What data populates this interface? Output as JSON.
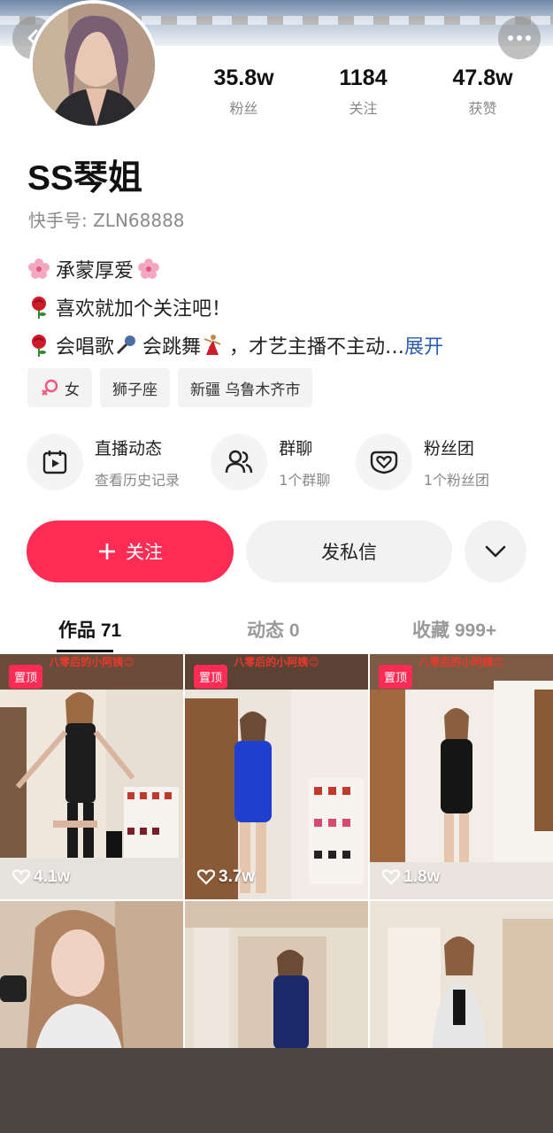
{
  "header": {
    "back_icon": "chevron-left-icon",
    "more_icon": "more-dots-icon"
  },
  "profile": {
    "name": "SS琴姐",
    "kuaishou_id": "快手号: ZLN68888",
    "stats": [
      {
        "value": "35.8w",
        "label": "粉丝"
      },
      {
        "value": "1184",
        "label": "关注"
      },
      {
        "value": "47.8w",
        "label": "获赞"
      }
    ],
    "bio": [
      {
        "emoji": "cherry-blossom-icon",
        "text": "承蒙厚爱"
      },
      {
        "emoji": "rose-icon",
        "text": "喜欢就加个关注吧！"
      },
      {
        "emoji": "rose-icon",
        "text_a": "会唱歌",
        "text_b": "会跳舞",
        "text_c": "，才艺主播不主动…",
        "expand": "展开"
      }
    ],
    "tags": [
      {
        "icon": "female-icon",
        "text": "女"
      },
      {
        "text": "狮子座"
      },
      {
        "text": "新疆 乌鲁木齐市"
      }
    ]
  },
  "actions": [
    {
      "icon": "calendar-play-icon",
      "title": "直播动态",
      "subtitle": "查看历史记录"
    },
    {
      "icon": "group-chat-icon",
      "title": "群聊",
      "subtitle": "1个群聊"
    },
    {
      "icon": "fan-club-heart-icon",
      "title": "粉丝团",
      "subtitle": "1个粉丝团"
    }
  ],
  "buttons": {
    "follow": "关注",
    "message": "发私信"
  },
  "tabs": [
    {
      "label": "作品 71",
      "active": true
    },
    {
      "label": "动态 0",
      "active": false
    },
    {
      "label": "收藏 999+",
      "active": false
    }
  ],
  "videos": [
    {
      "pinned": "置顶",
      "likes": "4.1w",
      "caption": "八零后的小阿姨😊"
    },
    {
      "pinned": "置顶",
      "likes": "3.7w",
      "caption": "八零后的小阿姨😊"
    },
    {
      "pinned": "置顶",
      "likes": "1.8w",
      "caption": "八零后的小阿姨😊"
    },
    {
      "likes": ""
    },
    {
      "likes": ""
    },
    {
      "likes": ""
    }
  ],
  "colors": {
    "accent": "#fe2c55",
    "link": "#2c5dad",
    "muted": "#888888"
  }
}
